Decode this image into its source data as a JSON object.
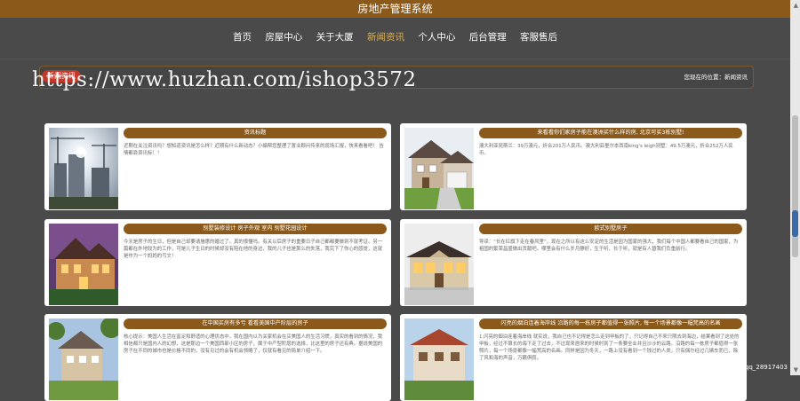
{
  "site": {
    "title": "房地产管理系统"
  },
  "nav": {
    "items": [
      {
        "label": "首页"
      },
      {
        "label": "房屋中心"
      },
      {
        "label": "关于大厦"
      },
      {
        "label": "新闻资讯"
      },
      {
        "label": "个人中心"
      },
      {
        "label": "后台管理"
      },
      {
        "label": "客服售后"
      }
    ],
    "active_index": 3,
    "active_color": "#e0b24a"
  },
  "breadcrumb": {
    "badge": "新闻资讯",
    "location": "您现在的位置：新闻资讯"
  },
  "watermark": "https://www.huzhan.com/ishop3572",
  "news": [
    {
      "title": "资讯标题",
      "desc": "近期在关注资讯吗？想知道资讯是怎么样？近期有什么新动态？小编帮您整理了置业顾问传来的现场汇报，快来看看吧！ 告情都靠资讯标！！"
    },
    {
      "title": "来看看你们家房子能在澳洲买什么样的房, 北京可买3栋别墅!",
      "desc": "澳大利亚昆斯兰：39万澳元，折合201万人民币。澳大利亚墨尔本西南king's leigh别墅：49.5万澳元，折合252万人民币。"
    },
    {
      "title": "别墅装修设计 房子外观 室内 别墅花园设计",
      "desc": "今天是房子的生日，但是自己却要请施惠的婚过了。真的很懂吗。有关以后房子的重要日子自己都都要做到不就考证。另一篇都在外地较为的工作，可是儿子生日的时候却没有陪在他的身边，我的儿子也是那么的失落，我完下了你心的感觉，这就是作为一个妈妈的弓文！"
    },
    {
      "title": "欧式别墅房子",
      "desc": "导读：“长在红旗下走在春风里”，现在之所以有这么安定的生活是因为国家的强大，我们每个中国人都要看自己的国家，为祖国的繁荣昌盛做出贡献吧。哪里会有什么岁月静好，生于听，长于听，就是有人替我们负重前行。"
    },
    {
      "title": "在中国买房有多亏 看看美国中产阶层的房子",
      "desc": "核心提示：美国人生活在富足和舒适的心理状态中，我在国内以为关家机会在买美国人的生活习惯，真实的看到的情况，我相信都只是国内人的幻想，这是那边一个美国西部小区的房子，属于中产型阶层的选择，比这里的房子还有典。据说美国的房子在不同的城市也是价格不同的，没有见过的会有机会领略了，仅就有看见的简单介绍一下。"
    },
    {
      "title": "闪亮的烟泊连着海岸线 沿路的每一栋房子都值得一张照片, 每一个场景都像一幅梵高的名画",
      "desc": "1.闪亮的烟泊连着海岸线 就实说，我自己也不记得是怎么走到甲板的了，只记得自己不来只限去到海边，结果看到了这处的甲板，经过不算长的海下走了过去，不过现来居来的时候时到了一条要全业并且沙沙的云路。沿路的每一栋房子都值得一张照片，每一个场景都像一幅梵高的名画。同样是因为冬天，一路上没有看到一个钱过的人类，只有偶尔经过几辆车而已，除了风和海的声音，万籁俱寂。"
    }
  ],
  "csdn_mark": "CSDN @qq_28917403"
}
